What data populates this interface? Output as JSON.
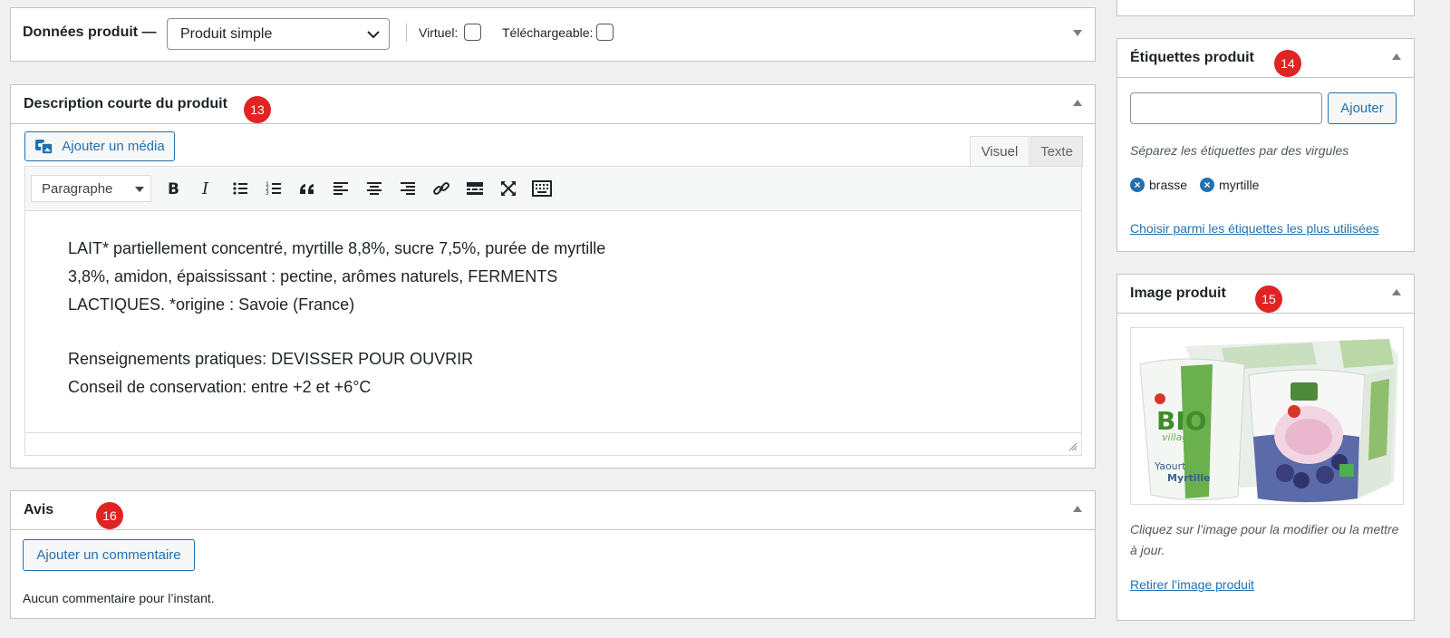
{
  "product_data": {
    "title": "Données produit —",
    "type_select": "Produit simple",
    "virtual_label": "Virtuel:",
    "downloadable_label": "Téléchargeable:"
  },
  "short_description": {
    "title": "Description courte du produit",
    "badge": "13",
    "add_media": "Ajouter un média",
    "tab_visual": "Visuel",
    "tab_text": "Texte",
    "format_select": "Paragraphe",
    "lines": [
      "LAIT* partiellement concentré, myrtille 8,8%, sucre 7,5%, purée de myrtille",
      "3,8%, amidon, épaississant : pectine, arômes naturels, FERMENTS",
      "LACTIQUES. *origine : Savoie (France)",
      "Renseignements pratiques: DEVISSER POUR OUVRIR",
      "Conseil de conservation: entre +2 et +6°C"
    ]
  },
  "reviews": {
    "title": "Avis",
    "badge": "16",
    "add_comment": "Ajouter un commentaire",
    "empty": "Aucun commentaire pour l’instant."
  },
  "tags": {
    "title": "Étiquettes produit",
    "badge": "14",
    "add_button": "Ajouter",
    "help": "Séparez les étiquettes par des virgules",
    "items": [
      "brasse",
      "myrtille"
    ],
    "most_used_link": "Choisir parmi les étiquettes les plus utilisées"
  },
  "product_image": {
    "title": "Image produit",
    "badge": "15",
    "brand": "BIO",
    "brand_sub": "village",
    "product_name": "Yaourt",
    "product_flavor": "Myrtille",
    "help": "Cliquez sur l’image pour la modifier ou la mettre à jour.",
    "remove_link": "Retirer l’image produit"
  },
  "colors": {
    "accent": "#2271b1",
    "badge": "#e02424",
    "border": "#c3c4c7"
  }
}
